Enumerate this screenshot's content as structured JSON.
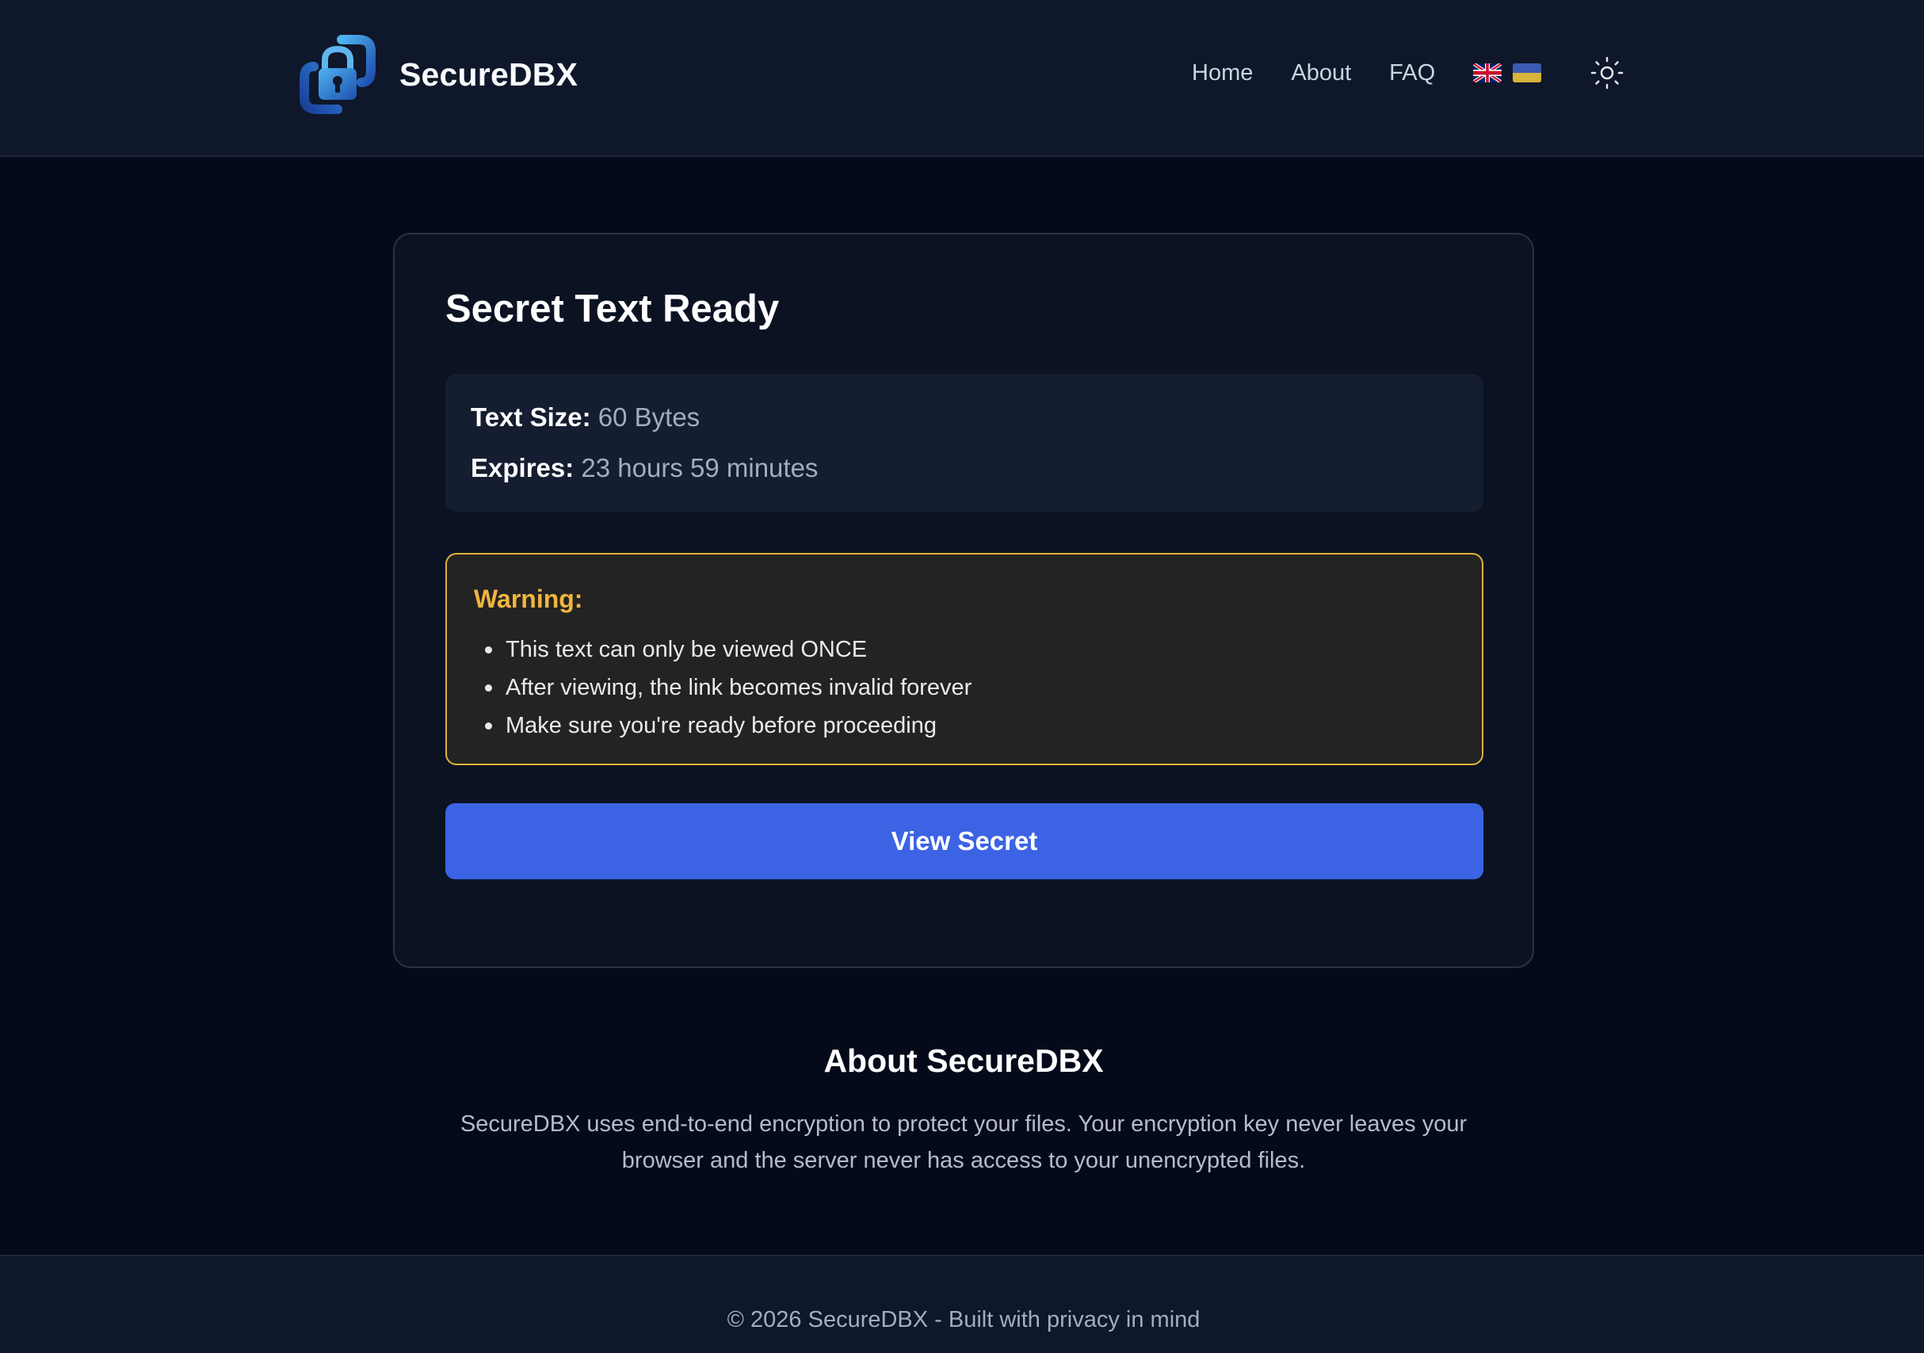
{
  "header": {
    "brand_name": "SecureDBX",
    "nav": {
      "home": "Home",
      "about": "About",
      "faq": "FAQ"
    },
    "languages": [
      "en-flag-icon",
      "ua-flag-icon"
    ],
    "theme_toggle_icon": "sun-icon"
  },
  "card": {
    "title": "Secret Text Ready",
    "info": {
      "size_label": "Text Size:",
      "size_value": "60 Bytes",
      "expires_label": "Expires:",
      "expires_value": "23 hours 59 minutes"
    },
    "warning": {
      "title": "Warning:",
      "items": [
        "This text can only be viewed ONCE",
        "After viewing, the link becomes invalid forever",
        "Make sure you're ready before proceeding"
      ]
    },
    "button_label": "View Secret"
  },
  "about": {
    "title": "About SecureDBX",
    "text": "SecureDBX uses end-to-end encryption to protect your files. Your encryption key never leaves your browser and the server never has access to your unencrypted files."
  },
  "footer": {
    "text": "© 2026 SecureDBX - Built with privacy in mind"
  },
  "colors": {
    "background": "#050a1a",
    "header": "#0f172a",
    "primary_button": "#3b63e3",
    "warning_accent": "#e2b33a"
  }
}
